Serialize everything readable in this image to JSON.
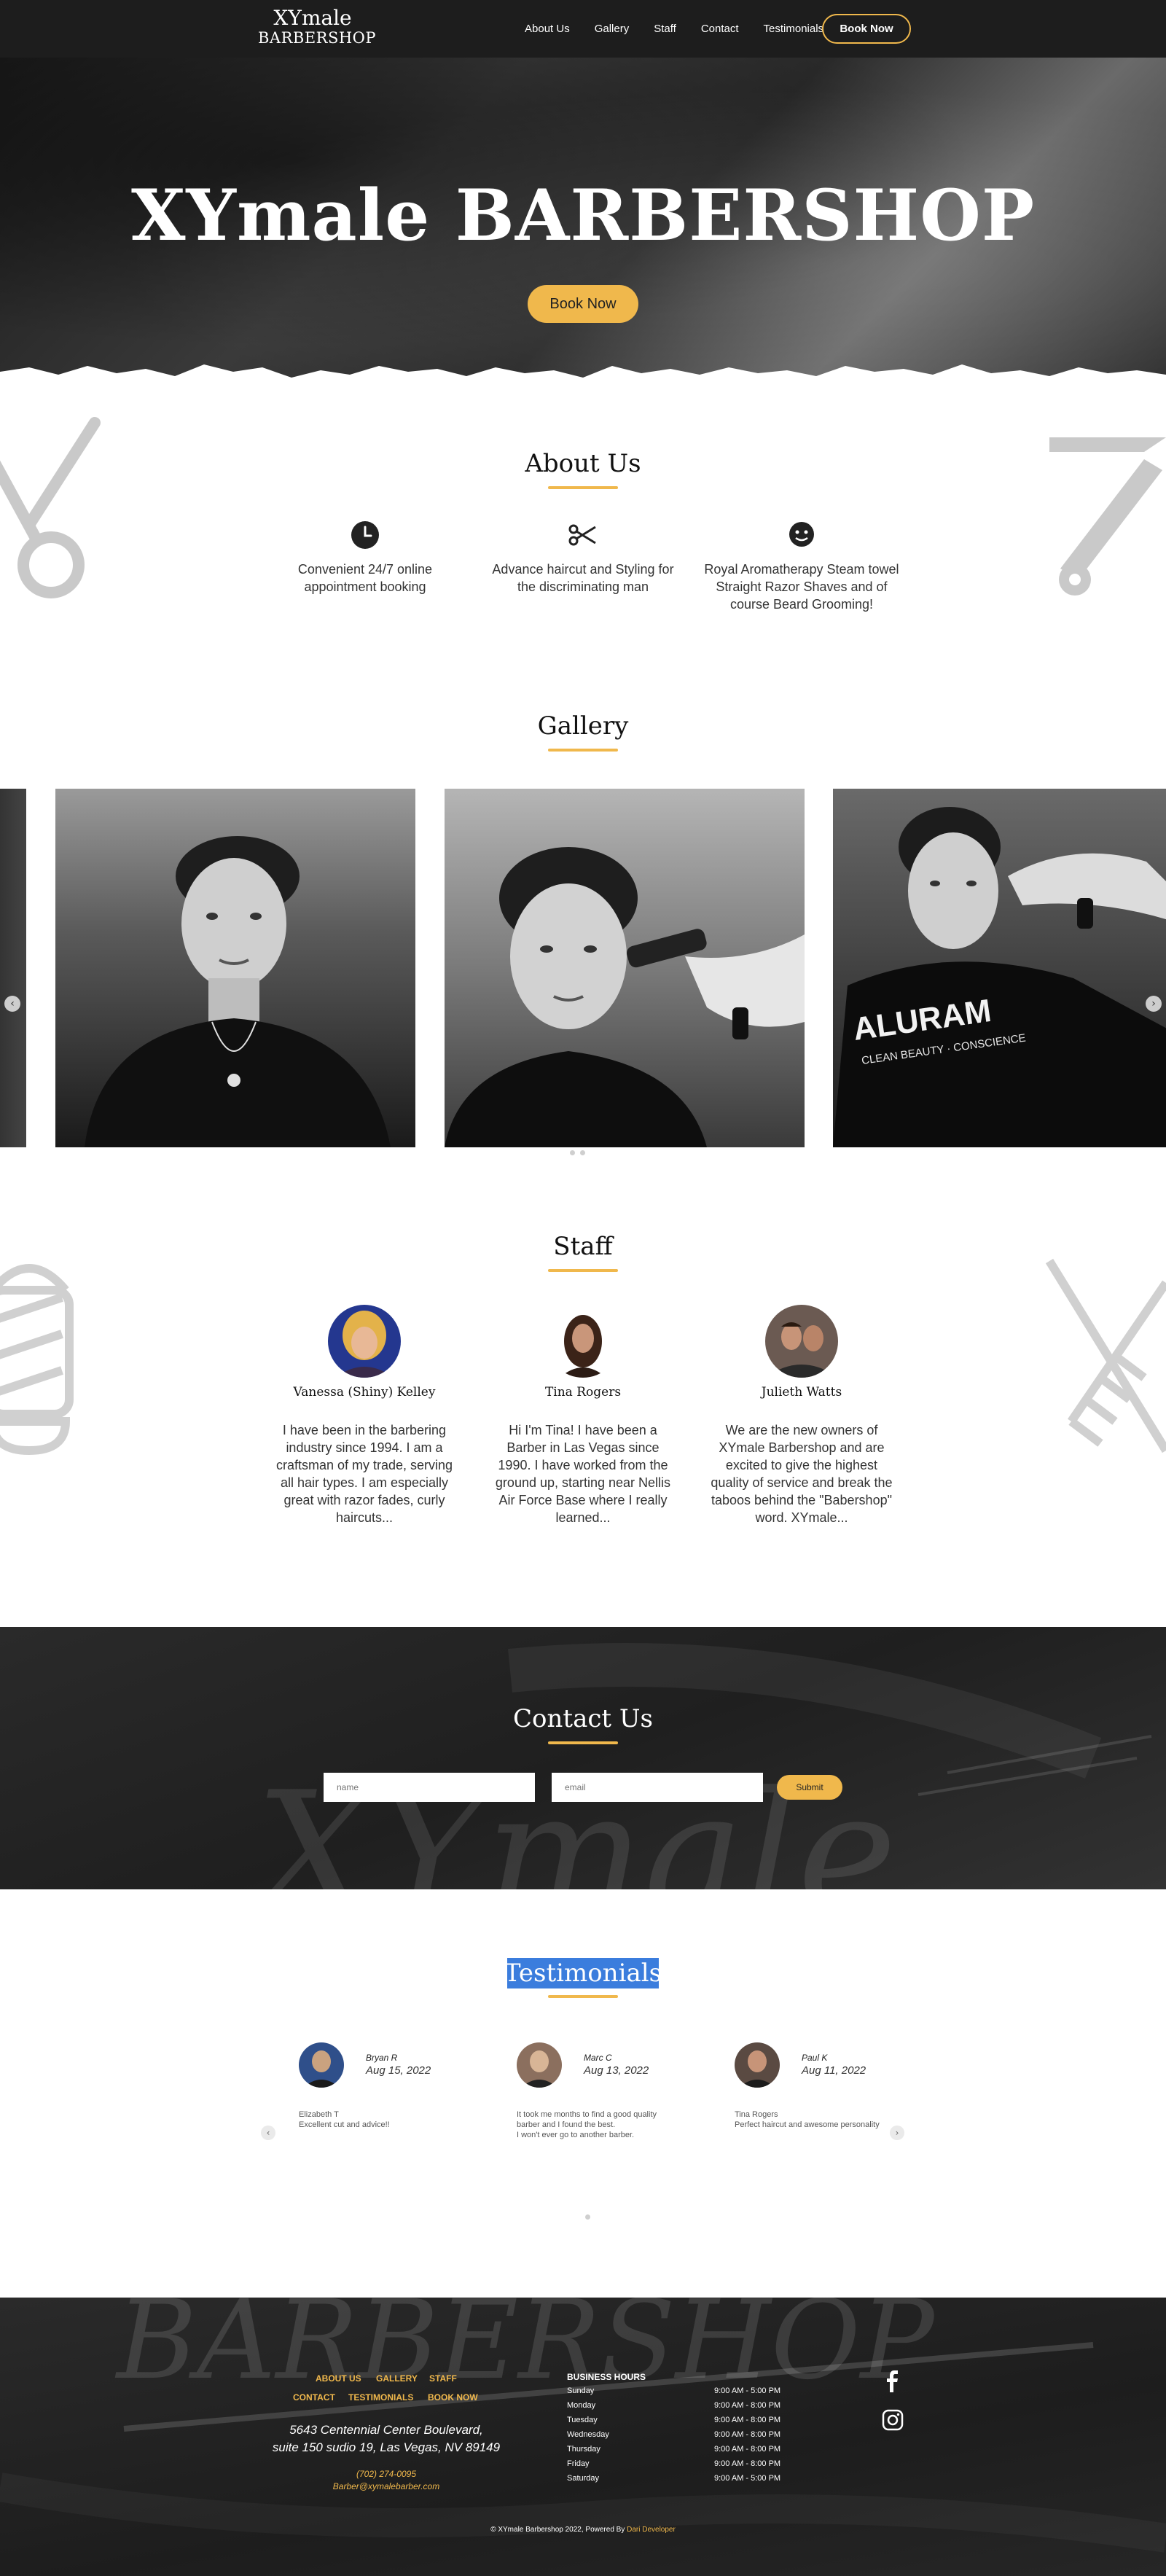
{
  "nav": {
    "logo_top": "XYmale",
    "logo_bottom": "BARBERSHOP",
    "links": [
      "About Us",
      "Gallery",
      "Staff",
      "Contact",
      "Testimonials"
    ],
    "book_label": "Book Now"
  },
  "hero": {
    "title": "XYmale BARBERSHOP",
    "book_label": "Book Now"
  },
  "about": {
    "title": "About Us",
    "features": [
      {
        "icon": "clock-icon",
        "text": "Convenient 24/7 online appointment booking"
      },
      {
        "icon": "scissors-icon",
        "text": "Advance haircut and Styling for the discriminating man"
      },
      {
        "icon": "bearded-face-icon",
        "text": "Royal Aromatherapy Steam towel Straight Razor Shaves and of course Beard Grooming!"
      }
    ]
  },
  "gallery": {
    "title": "Gallery",
    "cape_text": "ALURAM",
    "cape_subtext": "CLEAN BEAUTY · CONSCIENCE"
  },
  "staff": {
    "title": "Staff",
    "members": [
      {
        "name": "Vanessa (Shiny) Kelley",
        "bio": "I have been in the barbering industry since 1994. I am a craftsman of my trade, serving all hair types. I am especially great with razor fades, curly haircuts..."
      },
      {
        "name": "Tina Rogers",
        "bio": "Hi I'm Tina! I have been a Barber in Las Vegas since 1990. I have worked from the ground up, starting near Nellis Air Force Base where I really learned..."
      },
      {
        "name": "Julieth Watts",
        "bio": "We are the new owners of XYmale Barbershop and are excited to give the highest quality of service and break the taboos behind the \"Babershop\" word. XYmale..."
      }
    ]
  },
  "contact": {
    "title": "Contact Us",
    "name_placeholder": "name",
    "email_placeholder": "email",
    "submit_label": "Submit",
    "watermark": "XYmale"
  },
  "testimonials": {
    "title": "Testimonials",
    "items": [
      {
        "name": "Bryan R",
        "date": "Aug 15, 2022",
        "body_line1": "Elizabeth T",
        "body_line2": "Excellent cut and advice!!"
      },
      {
        "name": "Marc C",
        "date": "Aug 13, 2022",
        "body_line1": "It took me months to find a good quality barber and I found the best.",
        "body_line2": "I won't ever go to another barber."
      },
      {
        "name": "Paul K",
        "date": "Aug 11, 2022",
        "body_line1": "Tina Rogers",
        "body_line2": "Perfect haircut and awesome personality"
      }
    ]
  },
  "footer": {
    "watermark": "BARBERSHOP",
    "links_row1": [
      "ABOUT US",
      "GALLERY",
      "STAFF"
    ],
    "links_row2": [
      "CONTACT",
      "TESTIMONIALS",
      "BOOK NOW"
    ],
    "address_line1": "5643 Centennial Center Boulevard,",
    "address_line2": "suite 150 sudio 19, Las Vegas, NV 89149",
    "phone": "(702) 274-0095",
    "email": "Barber@xymalebarber.com",
    "hours_title": "BUSINESS HOURS",
    "hours": [
      {
        "day": "Sunday",
        "time": "9:00 AM - 5:00 PM"
      },
      {
        "day": "Monday",
        "time": "9:00 AM - 8:00 PM"
      },
      {
        "day": "Tuesday",
        "time": "9:00 AM - 8:00 PM"
      },
      {
        "day": "Wednesday",
        "time": "9:00 AM - 8:00 PM"
      },
      {
        "day": "Thursday",
        "time": "9:00 AM - 8:00 PM"
      },
      {
        "day": "Friday",
        "time": "9:00 AM - 8:00 PM"
      },
      {
        "day": "Saturday",
        "time": "9:00 AM - 5:00 PM"
      }
    ],
    "copyright_prefix": "© XYmale Barbershop 2022, Powered By",
    "copyright_link": "Dari Developer"
  },
  "colors": {
    "accent": "#f0b84c",
    "dark": "#1d1d1d",
    "selection": "#3b7ddd"
  }
}
